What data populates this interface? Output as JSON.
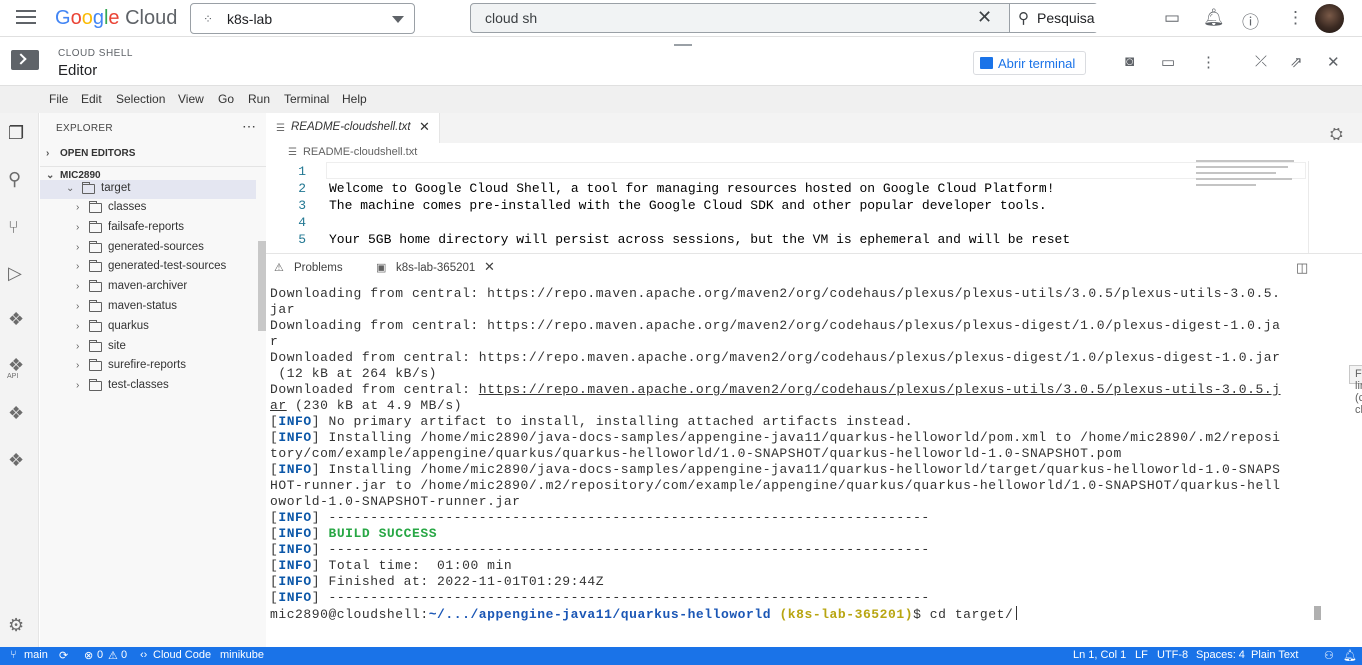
{
  "topbar": {
    "logo": {
      "g": "G",
      "o1": "o",
      "o2": "o",
      "g2": "g",
      "l": "l",
      "e": "e",
      "cloud": "Cloud"
    },
    "project": "k8s-lab",
    "search_value": "cloud sh",
    "search_button": "Pesquisa"
  },
  "header": {
    "small_title": "CLOUD SHELL",
    "title": "Editor",
    "open_terminal": "Abrir terminal"
  },
  "menu": [
    "File",
    "Edit",
    "Selection",
    "View",
    "Go",
    "Run",
    "Terminal",
    "Help"
  ],
  "sidebar": {
    "title": "EXPLORER",
    "open_editors": "OPEN EDITORS",
    "workspace": "MIC2890",
    "tree": [
      {
        "label": "target",
        "expanded": true
      },
      {
        "label": "classes"
      },
      {
        "label": "failsafe-reports"
      },
      {
        "label": "generated-sources"
      },
      {
        "label": "generated-test-sources"
      },
      {
        "label": "maven-archiver"
      },
      {
        "label": "maven-status"
      },
      {
        "label": "quarkus"
      },
      {
        "label": "site"
      },
      {
        "label": "surefire-reports"
      },
      {
        "label": "test-classes"
      }
    ]
  },
  "editor": {
    "tab_name": "README-cloudshell.txt",
    "breadcrumb": "README-cloudshell.txt",
    "lines": [
      {
        "n": "1",
        "t": ""
      },
      {
        "n": "2",
        "t": "Welcome to Google Cloud Shell, a tool for managing resources hosted on Google Cloud Platform!"
      },
      {
        "n": "3",
        "t": "The machine comes pre-installed with the Google Cloud SDK and other popular developer tools."
      },
      {
        "n": "4",
        "t": ""
      },
      {
        "n": "5",
        "t": "Your 5GB home directory will persist across sessions, but the VM is ephemeral and will be reset"
      }
    ]
  },
  "panel": {
    "problems_tab": "Problems",
    "terminal_tab": "k8s-lab-365201",
    "tooltip": "Follow link (ctrl + click)",
    "lines": [
      "Downloading from central: https://repo.maven.apache.org/maven2/org/codehaus/plexus/plexus-utils/3.0.5/plexus-utils-3.0.5.",
      "jar",
      "Downloading from central: https://repo.maven.apache.org/maven2/org/codehaus/plexus/plexus-digest/1.0/plexus-digest-1.0.jar",
      "r",
      "Downloaded from central: https://repo.maven.apache.org/maven2/org/codehaus/plexus/plexus-digest/1.0/plexus-digest-1.0.jar",
      " (12 kB at 264 kB/s)",
      "Downloaded from central: https://repo.maven.apache.org/maven2/org/codehaus/plexus/plexus-utils/3.0.5/plexus-utils-3.0.5.j",
      "ar (230 kB at 4.9 MB/s)"
    ],
    "info_tag": "INFO",
    "info_lines": [
      " No primary artifact to install, installing attached artifacts instead.",
      " Installing /home/mic2890/java-docs-samples/appengine-java11/quarkus-helloworld/pom.xml to /home/mic2890/.m2/reposi",
      "tory/com/example/appengine/quarkus/quarkus-helloworld/1.0-SNAPSHOT/quarkus-helloworld-1.0-SNAPSHOT.pom",
      " Installing /home/mic2890/java-docs-samples/appengine-java11/quarkus-helloworld/target/quarkus-helloworld-1.0-SNAPS",
      "HOT-runner.jar to /home/mic2890/.m2/repository/com/example/appengine/quarkus/quarkus-helloworld/1.0-SNAPSHOT/quarkus-hell",
      "oworld-1.0-SNAPSHOT-runner.jar",
      " ------------------------------------------------------------------------",
      " BUILD SUCCESS",
      " ------------------------------------------------------------------------",
      " Total time:  01:00 min",
      " Finished at: 2022-11-01T01:29:44Z",
      " ------------------------------------------------------------------------"
    ],
    "prompt_user": "mic2890@cloudshell:",
    "prompt_path": "~/.../appengine-java11/quarkus-helloworld",
    "prompt_project": " (k8s-lab-365201)",
    "prompt_cmd": "$ cd target/"
  },
  "status": {
    "branch": "main",
    "errors": "0",
    "warnings": "0",
    "cloud_code": "Cloud Code",
    "minikube": "minikube",
    "position": "Ln 1, Col 1",
    "eol": "LF",
    "encoding": "UTF-8",
    "spaces": "Spaces: 4",
    "language": "Plain Text"
  }
}
